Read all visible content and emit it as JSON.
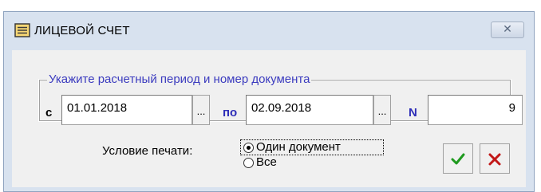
{
  "window": {
    "title": "ЛИЦЕВОЙ СЧЕТ",
    "close_glyph": "✕"
  },
  "period_group": {
    "legend": "Укажите расчетный период и номер документа",
    "from_label": "с",
    "from_value": "01.01.2018",
    "from_picker": "...",
    "to_label": "по",
    "to_value": "02.09.2018",
    "to_picker": "...",
    "number_label": "N",
    "number_value": "9"
  },
  "print_condition": {
    "label": "Условие печати:",
    "options": [
      {
        "label": "Один документ",
        "selected": true
      },
      {
        "label": "Все",
        "selected": false
      }
    ]
  },
  "buttons": {
    "ok_icon": "checkmark-icon",
    "cancel_icon": "cross-icon",
    "ok_color": "#1f9a1f",
    "cancel_color": "#c21818"
  }
}
